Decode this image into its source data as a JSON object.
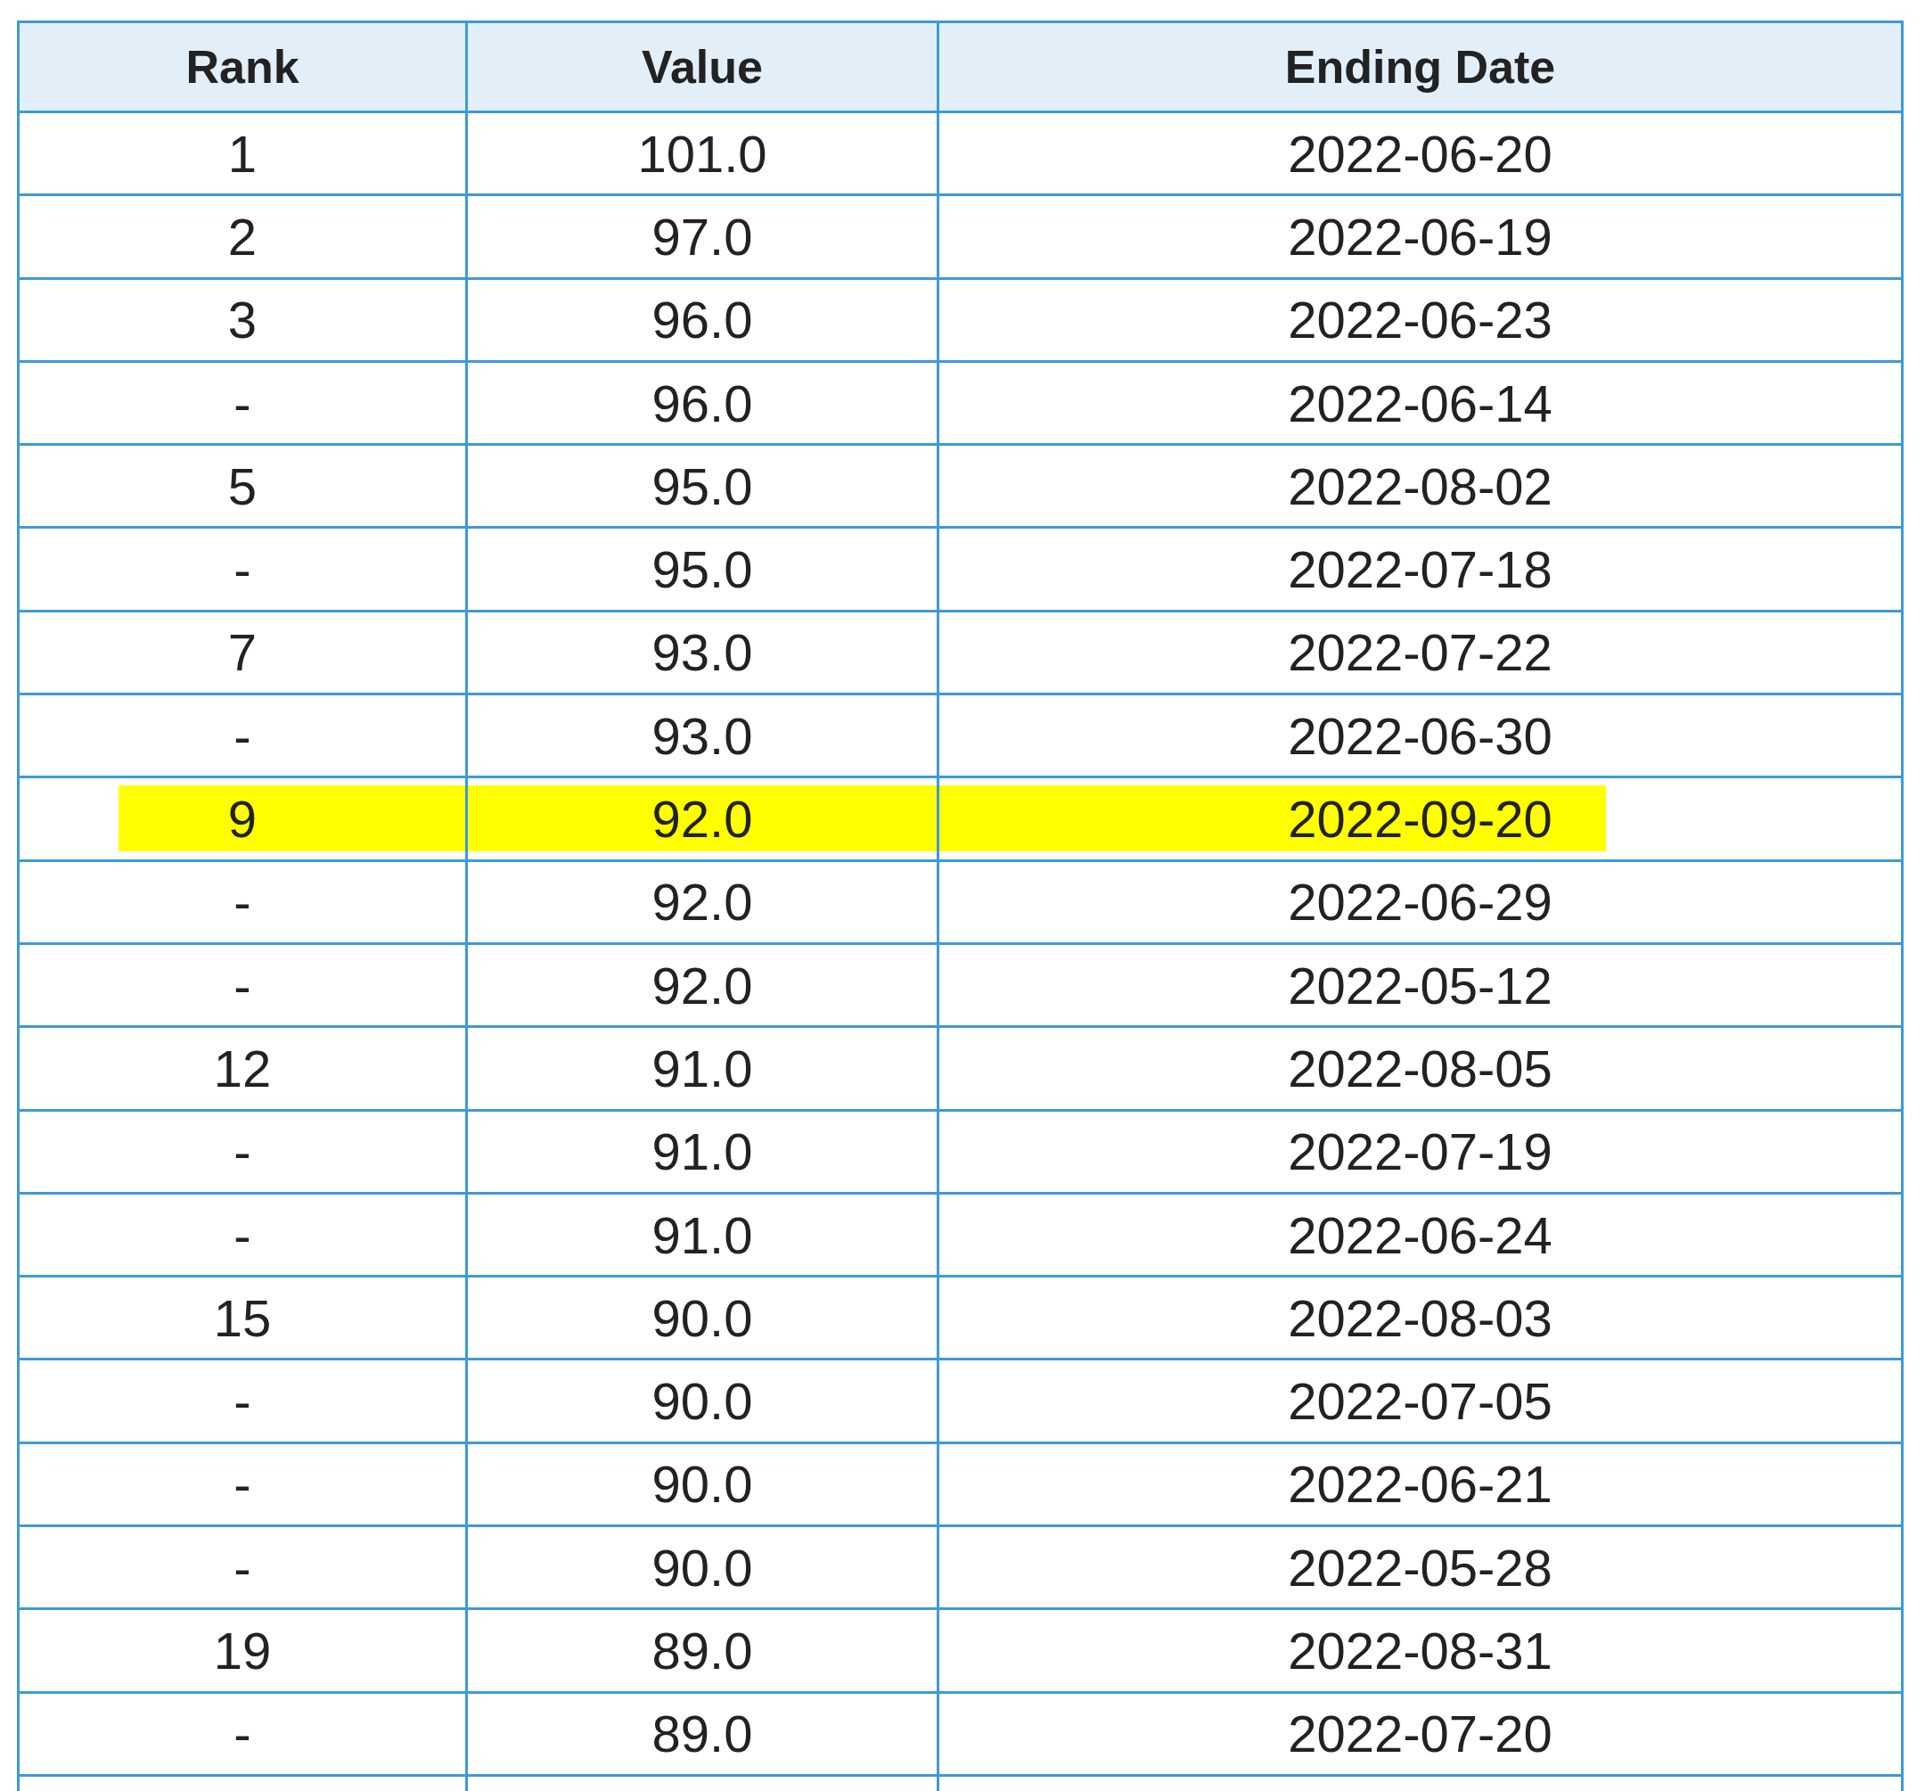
{
  "table": {
    "columns": [
      "Rank",
      "Value",
      "Ending Date"
    ],
    "rows": [
      {
        "rank": "1",
        "value": "101.0",
        "date": "2022-06-20",
        "highlighted": false
      },
      {
        "rank": "2",
        "value": "97.0",
        "date": "2022-06-19",
        "highlighted": false
      },
      {
        "rank": "3",
        "value": "96.0",
        "date": "2022-06-23",
        "highlighted": false
      },
      {
        "rank": "-",
        "value": "96.0",
        "date": "2022-06-14",
        "highlighted": false
      },
      {
        "rank": "5",
        "value": "95.0",
        "date": "2022-08-02",
        "highlighted": false
      },
      {
        "rank": "-",
        "value": "95.0",
        "date": "2022-07-18",
        "highlighted": false
      },
      {
        "rank": "7",
        "value": "93.0",
        "date": "2022-07-22",
        "highlighted": false
      },
      {
        "rank": "-",
        "value": "93.0",
        "date": "2022-06-30",
        "highlighted": false
      },
      {
        "rank": "9",
        "value": "92.0",
        "date": "2022-09-20",
        "highlighted": true
      },
      {
        "rank": "-",
        "value": "92.0",
        "date": "2022-06-29",
        "highlighted": false
      },
      {
        "rank": "-",
        "value": "92.0",
        "date": "2022-05-12",
        "highlighted": false
      },
      {
        "rank": "12",
        "value": "91.0",
        "date": "2022-08-05",
        "highlighted": false
      },
      {
        "rank": "-",
        "value": "91.0",
        "date": "2022-07-19",
        "highlighted": false
      },
      {
        "rank": "-",
        "value": "91.0",
        "date": "2022-06-24",
        "highlighted": false
      },
      {
        "rank": "15",
        "value": "90.0",
        "date": "2022-08-03",
        "highlighted": false
      },
      {
        "rank": "-",
        "value": "90.0",
        "date": "2022-07-05",
        "highlighted": false
      },
      {
        "rank": "-",
        "value": "90.0",
        "date": "2022-06-21",
        "highlighted": false
      },
      {
        "rank": "-",
        "value": "90.0",
        "date": "2022-05-28",
        "highlighted": false
      },
      {
        "rank": "19",
        "value": "89.0",
        "date": "2022-08-31",
        "highlighted": false
      },
      {
        "rank": "-",
        "value": "89.0",
        "date": "2022-07-20",
        "highlighted": false
      }
    ]
  }
}
